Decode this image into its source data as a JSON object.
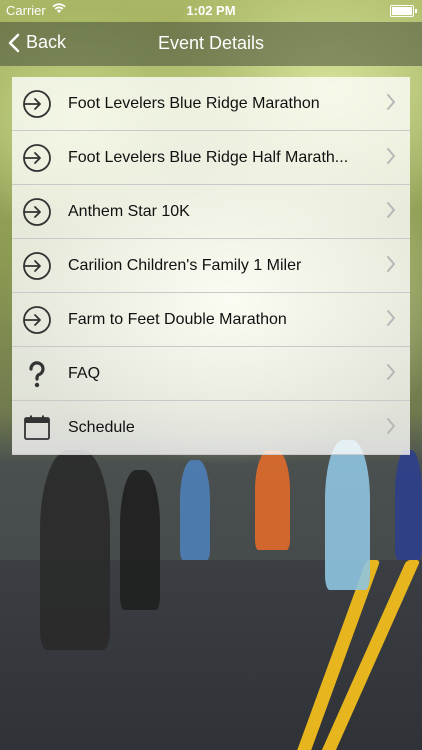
{
  "status": {
    "carrier": "Carrier",
    "time": "1:02 PM"
  },
  "nav": {
    "back_label": "Back",
    "title": "Event Details"
  },
  "items": [
    {
      "label": "Foot Levelers Blue Ridge Marathon",
      "icon": "arrow-in-circle-icon"
    },
    {
      "label": "Foot Levelers Blue Ridge Half Marath...",
      "icon": "arrow-in-circle-icon"
    },
    {
      "label": "Anthem Star 10K",
      "icon": "arrow-in-circle-icon"
    },
    {
      "label": "Carilion Children's Family 1 Miler",
      "icon": "arrow-in-circle-icon"
    },
    {
      "label": "Farm to Feet Double Marathon",
      "icon": "arrow-in-circle-icon"
    },
    {
      "label": "FAQ",
      "icon": "question-mark-icon"
    },
    {
      "label": "Schedule",
      "icon": "calendar-icon"
    }
  ]
}
